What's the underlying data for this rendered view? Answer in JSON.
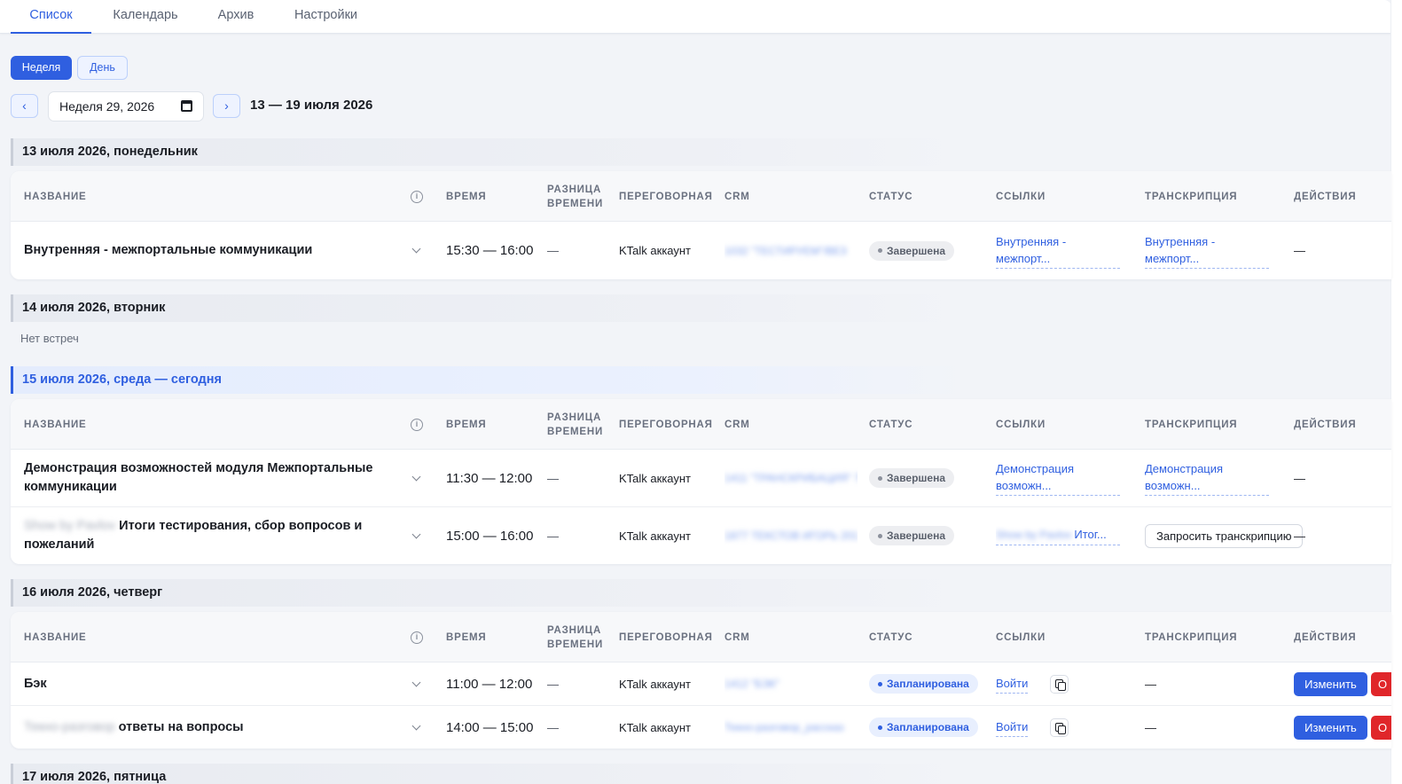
{
  "tabs": [
    "Список",
    "Календарь",
    "Архив",
    "Настройки"
  ],
  "mode": {
    "week": "Неделя",
    "day": "День"
  },
  "week_picker": {
    "prev": "‹",
    "next": "›",
    "value": "Неделя 29, 2026",
    "range": "13 — 19 июля 2026"
  },
  "columns": [
    "НАЗВАНИЕ",
    "ВРЕМЯ",
    "РАЗНИЦА",
    "ВРЕМЕНИ",
    "ПЕРЕГОВОРНАЯ",
    "CRM",
    "СТАТУС",
    "ССЫЛКИ",
    "ТРАНСКРИПЦИЯ",
    "ДЕЙСТВИЯ"
  ],
  "days": [
    {
      "label": "13 июля 2026, понедельник",
      "meetings": [
        {
          "prefix": "",
          "title": "Внутренняя - межпортальные коммуникации",
          "time": "15:30 — 16:00",
          "diff": "—",
          "room": "KTalk аккаунт",
          "crm": "1032 \"ТЕСТИРУЕМ\"/ВЕЗ",
          "status": "Завершена",
          "link": "Внутренняя - межпорт...",
          "transcript": "Внутренняя - межпорт...",
          "actions": "—"
        }
      ]
    },
    {
      "label": "14 июля 2026, вторник",
      "empty": "Нет встреч"
    },
    {
      "label": "15 июля 2026, среда — сегодня",
      "meetings": [
        {
          "prefix": "",
          "title": "Демонстрация возможностей модуля Межпортальные коммуникации",
          "time": "11:30 — 12:00",
          "diff": "—",
          "room": "KTalk аккаунт",
          "crm": "1411 \"ТРАНСКРИБАЦИЯ\" 7954",
          "status": "Завершена",
          "link": "Демонстрация возможн...",
          "transcript": "Демонстрация возможн...",
          "actions": "—"
        },
        {
          "prefix": "Show by Pavlov",
          "title": "Итоги тестирования, сбор вопросов и пожеланий",
          "time": "15:00 — 16:00",
          "diff": "—",
          "room": "KTalk аккаунт",
          "crm": "1877 ТЕКСТОВ ИГОРЬ 201",
          "status": "Завершена",
          "link_prefix": "Show by Pavlov",
          "link": "Итог...",
          "transcript_button": "Запросить транскрипцию",
          "actions": "—"
        }
      ]
    },
    {
      "label": "16 июля 2026, четверг",
      "meetings": [
        {
          "prefix": "",
          "title": "Бэк",
          "time": "11:00 — 12:00",
          "diff": "—",
          "room": "KTalk аккаунт",
          "crm": "1412 \"БЭК\"",
          "status": "Запланирована",
          "link": "Войти",
          "transcript": "—",
          "edit": "Изменить",
          "cancel": "О"
        },
        {
          "prefix": "Текно-разговор",
          "title": "ответы на вопросы",
          "time": "14:00 — 15:00",
          "diff": "—",
          "room": "KTalk аккаунт",
          "crm": "Текно-разговор_рассказ",
          "status": "Запланирована",
          "link": "Войти",
          "transcript": "—",
          "edit": "Изменить",
          "cancel": "О"
        }
      ]
    },
    {
      "label": "17 июля 2026, пятница"
    }
  ]
}
